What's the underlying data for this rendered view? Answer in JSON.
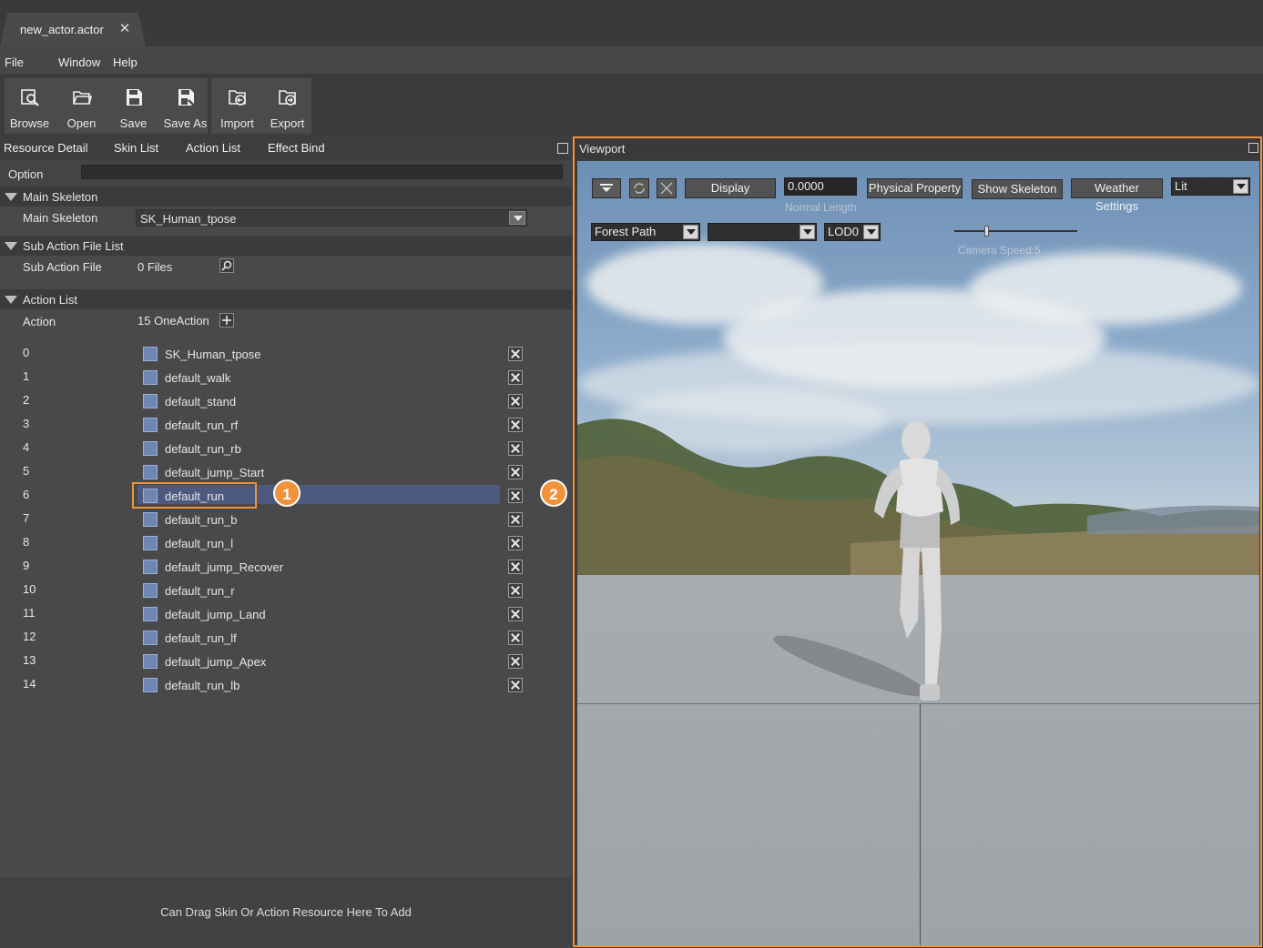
{
  "document_tab": {
    "title": "new_actor.actor",
    "close": "✕"
  },
  "menu": {
    "file": "File",
    "window": "Window",
    "help": "Help"
  },
  "toolbar": {
    "browse": "Browse",
    "open": "Open",
    "save": "Save",
    "save_as": "Save As",
    "import": "Import",
    "export": "Export"
  },
  "panel_tabs": {
    "resource_detail": "Resource Detail",
    "skin_list": "Skin List",
    "action_list": "Action List",
    "effect_bind": "Effect Bind"
  },
  "option": {
    "label": "Option",
    "value": ""
  },
  "main_skeleton": {
    "header": "Main Skeleton",
    "label": "Main Skeleton",
    "value": "SK_Human_tpose"
  },
  "sub_action": {
    "header": "Sub Action File List",
    "label": "Sub Action File",
    "value": "0 Files"
  },
  "action_list": {
    "header": "Action List",
    "label": "Action",
    "count": "15 OneAction",
    "items": [
      {
        "index": "0",
        "name": "SK_Human_tpose"
      },
      {
        "index": "1",
        "name": "default_walk"
      },
      {
        "index": "2",
        "name": "default_stand"
      },
      {
        "index": "3",
        "name": "default_run_rf"
      },
      {
        "index": "4",
        "name": "default_run_rb"
      },
      {
        "index": "5",
        "name": "default_jump_Start"
      },
      {
        "index": "6",
        "name": "default_run"
      },
      {
        "index": "7",
        "name": "default_run_b"
      },
      {
        "index": "8",
        "name": "default_run_l"
      },
      {
        "index": "9",
        "name": "default_jump_Recover"
      },
      {
        "index": "10",
        "name": "default_run_r"
      },
      {
        "index": "11",
        "name": "default_jump_Land"
      },
      {
        "index": "12",
        "name": "default_run_lf"
      },
      {
        "index": "13",
        "name": "default_jump_Apex"
      },
      {
        "index": "14",
        "name": "default_run_lb"
      }
    ],
    "selected_index": 6
  },
  "callouts": {
    "one": "1",
    "two": "2",
    "color": "#f0923a"
  },
  "drop_hint": "Can Drag Skin Or Action Resource Here To Add",
  "viewport": {
    "title": "Viewport",
    "display": "Display",
    "normal_length_value": "0.0000",
    "normal_length_label": "Normal Length",
    "physical_property": "Physical Property",
    "show_skeleton": "Show Skeleton",
    "weather_settings": "Weather Settings",
    "lit": "Lit",
    "scene": "Forest Path",
    "scene2": "",
    "lod": "LOD0",
    "camera_speed": "Camera Speed:5"
  },
  "colors": {
    "accent": "#f0923a",
    "selection": "#4c5a80",
    "panel": "#494949"
  }
}
